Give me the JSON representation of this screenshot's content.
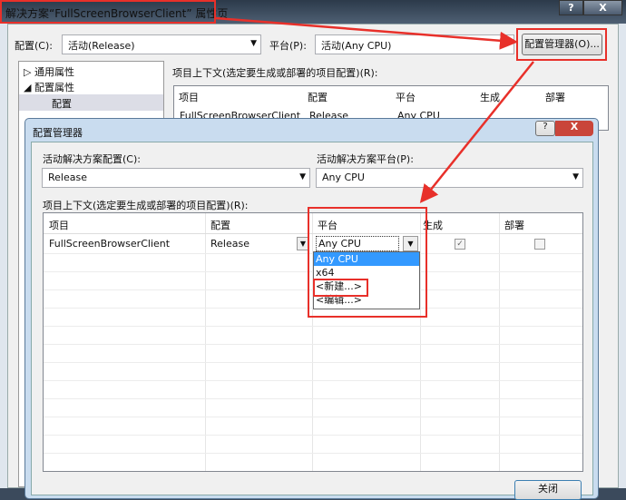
{
  "outer": {
    "title": "解决方案“FullScreenBrowserClient” 属性页",
    "help": "?",
    "close": "X",
    "config_label": "配置(C):",
    "config_value": "活动(Release)",
    "platform_label": "平台(P):",
    "platform_value": "活动(Any CPU)",
    "config_manager_button": "配置管理器(O)...",
    "tree": [
      "通用属性",
      "配置属性",
      "配置"
    ],
    "context_label": "项目上下文(选定要生成或部署的项目配置)(R):",
    "columns": [
      "项目",
      "配置",
      "平台",
      "生成",
      "部署"
    ],
    "row": {
      "project": "FullScreenBrowserClient",
      "config": "Release",
      "platform": "Any CPU"
    }
  },
  "dialog": {
    "title": "配置管理器",
    "help": "?",
    "close": "X",
    "active_config_label": "活动解决方案配置(C):",
    "active_config_value": "Release",
    "active_platform_label": "活动解决方案平台(P):",
    "active_platform_value": "Any CPU",
    "context_label": "项目上下文(选定要生成或部署的项目配置)(R):",
    "columns": [
      "项目",
      "配置",
      "平台",
      "生成",
      "部署"
    ],
    "row": {
      "project": "FullScreenBrowserClient",
      "config": "Release",
      "platform": "Any CPU"
    },
    "platform_options": [
      "Any CPU",
      "x64",
      "<新建...>",
      "<编辑...>"
    ],
    "close_button": "关闭"
  }
}
